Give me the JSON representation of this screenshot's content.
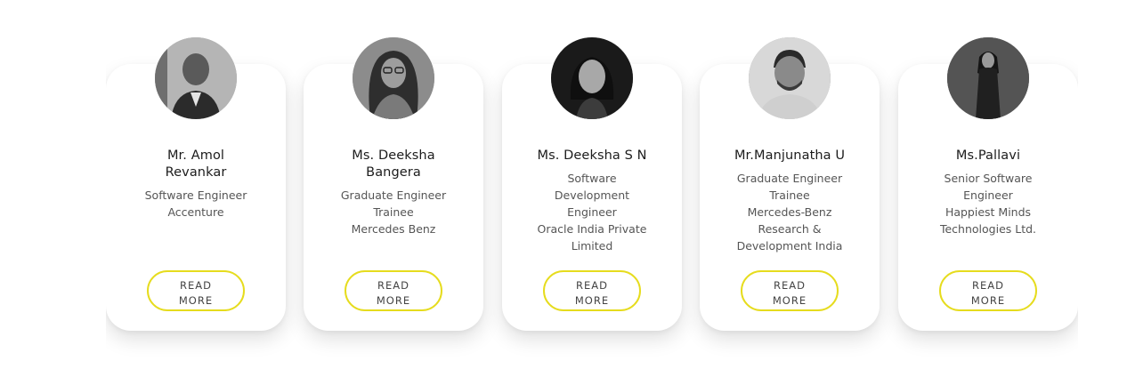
{
  "testimonials": [
    {
      "name": [
        "Mr. Amol",
        "Revankar"
      ],
      "role_lines": [
        "Software Engineer",
        "Accenture"
      ],
      "button": [
        "READ",
        "MORE"
      ]
    },
    {
      "name": [
        "Ms. Deeksha",
        "Bangera"
      ],
      "role_lines": [
        "Graduate Engineer",
        "Trainee",
        "Mercedes Benz"
      ],
      "button": [
        "READ",
        "MORE"
      ]
    },
    {
      "name": [
        "Ms. Deeksha S N"
      ],
      "role_lines": [
        "Software",
        "Development",
        "Engineer",
        "Oracle India Private",
        "Limited"
      ],
      "button": [
        "READ",
        "MORE"
      ]
    },
    {
      "name": [
        "Mr.Manjunatha U"
      ],
      "role_lines": [
        "Graduate Engineer",
        "Trainee",
        "Mercedes-Benz",
        "Research &",
        "Development India"
      ],
      "button": [
        "READ",
        "MORE"
      ]
    },
    {
      "name": [
        "Ms.Pallavi"
      ],
      "role_lines": [
        "Senior Software",
        "Engineer",
        "Happiest Minds",
        "Technologies Ltd."
      ],
      "button": [
        "READ",
        "MORE"
      ]
    }
  ],
  "colors": {
    "button_border": "#e6dc1e",
    "card_bg": "#ffffff",
    "text": "#1c1c1c",
    "muted": "#555555"
  }
}
